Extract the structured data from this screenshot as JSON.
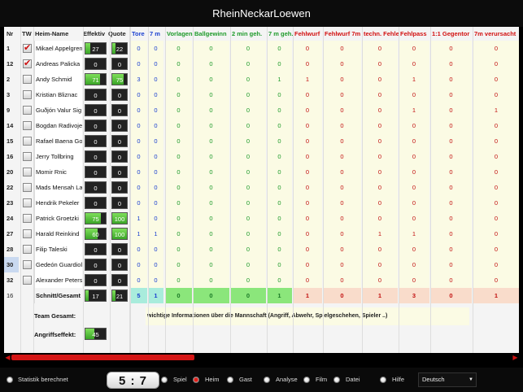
{
  "window": {
    "title": "RheinNeckarLoewen"
  },
  "colors": {
    "accent_red": "#d41515",
    "effekt_green": "#3aa427",
    "blue_stat": "#1a3fd0",
    "green_stat": "#1d9a2a",
    "red_stat": "#c21010"
  },
  "columns": {
    "nr": "Nr",
    "tw": "TW",
    "name": "Heim-Name",
    "effektiv": "Effektiv",
    "quote": "Quote",
    "stats": [
      {
        "label": "Tore",
        "color": "blue"
      },
      {
        "label": "7 m",
        "color": "blue"
      },
      {
        "label": "Vorlagen",
        "color": "green"
      },
      {
        "label": "Ballgewinn",
        "color": "green"
      },
      {
        "label": "2 min geh.",
        "color": "green"
      },
      {
        "label": "7 m geh.",
        "color": "green"
      },
      {
        "label": "Fehlwurf",
        "color": "red"
      },
      {
        "label": "Fehlwurf 7m",
        "color": "red"
      },
      {
        "label": "techn. Fehler",
        "color": "red"
      },
      {
        "label": "Fehlpass",
        "color": "red"
      },
      {
        "label": "1:1 Gegentor",
        "color": "red"
      },
      {
        "label": "7m verursacht",
        "color": "red"
      }
    ]
  },
  "players": [
    {
      "nr": "1",
      "tw": true,
      "name": "Mikael Appelgren",
      "effektiv": "27",
      "eff_level": 0.25,
      "quote": "22",
      "quo_level": 0.2,
      "stats": [
        "0",
        "0",
        "0",
        "0",
        "0",
        "0",
        "0",
        "0",
        "0",
        "0",
        "0",
        "0"
      ]
    },
    {
      "nr": "12",
      "tw": true,
      "name": "Andreas Palicka",
      "effektiv": "0",
      "eff_level": 0,
      "quote": "0",
      "quo_level": 0,
      "stats": [
        "0",
        "0",
        "0",
        "0",
        "0",
        "0",
        "0",
        "0",
        "0",
        "0",
        "0",
        "0"
      ]
    },
    {
      "nr": "2",
      "tw": false,
      "name": "Andy Schmid",
      "effektiv": "71",
      "eff_level": 0.7,
      "quote": "75",
      "quo_level": 0.75,
      "stats": [
        "3",
        "0",
        "0",
        "0",
        "0",
        "1",
        "1",
        "0",
        "0",
        "1",
        "0",
        "0"
      ]
    },
    {
      "nr": "3",
      "tw": false,
      "name": "Kristian Bliznac",
      "effektiv": "0",
      "eff_level": 0,
      "quote": "0",
      "quo_level": 0,
      "stats": [
        "0",
        "0",
        "0",
        "0",
        "0",
        "0",
        "0",
        "0",
        "0",
        "0",
        "0",
        "0"
      ]
    },
    {
      "nr": "9",
      "tw": false,
      "name": "Guðjón Valur Sig",
      "effektiv": "0",
      "eff_level": 0,
      "quote": "0",
      "quo_level": 0,
      "stats": [
        "0",
        "0",
        "0",
        "0",
        "0",
        "0",
        "0",
        "0",
        "0",
        "1",
        "0",
        "1"
      ]
    },
    {
      "nr": "14",
      "tw": false,
      "name": "Bogdan Radivoje",
      "effektiv": "0",
      "eff_level": 0,
      "quote": "0",
      "quo_level": 0,
      "stats": [
        "0",
        "0",
        "0",
        "0",
        "0",
        "0",
        "0",
        "0",
        "0",
        "0",
        "0",
        "0"
      ]
    },
    {
      "nr": "15",
      "tw": false,
      "name": "Rafael Baena Go",
      "effektiv": "0",
      "eff_level": 0,
      "quote": "0",
      "quo_level": 0,
      "stats": [
        "0",
        "0",
        "0",
        "0",
        "0",
        "0",
        "0",
        "0",
        "0",
        "0",
        "0",
        "0"
      ]
    },
    {
      "nr": "16",
      "tw": false,
      "name": "Jerry Tollbring",
      "effektiv": "0",
      "eff_level": 0,
      "quote": "0",
      "quo_level": 0,
      "stats": [
        "0",
        "0",
        "0",
        "0",
        "0",
        "0",
        "0",
        "0",
        "0",
        "0",
        "0",
        "0"
      ]
    },
    {
      "nr": "20",
      "tw": false,
      "name": "Momir Rnic",
      "effektiv": "0",
      "eff_level": 0,
      "quote": "0",
      "quo_level": 0,
      "stats": [
        "0",
        "0",
        "0",
        "0",
        "0",
        "0",
        "0",
        "0",
        "0",
        "0",
        "0",
        "0"
      ]
    },
    {
      "nr": "22",
      "tw": false,
      "name": "Mads Mensah La",
      "effektiv": "0",
      "eff_level": 0,
      "quote": "0",
      "quo_level": 0,
      "stats": [
        "0",
        "0",
        "0",
        "0",
        "0",
        "0",
        "0",
        "0",
        "0",
        "0",
        "0",
        "0"
      ]
    },
    {
      "nr": "23",
      "tw": false,
      "name": "Hendrik Pekeler",
      "effektiv": "0",
      "eff_level": 0,
      "quote": "0",
      "quo_level": 0,
      "stats": [
        "0",
        "0",
        "0",
        "0",
        "0",
        "0",
        "0",
        "0",
        "0",
        "0",
        "0",
        "0"
      ]
    },
    {
      "nr": "24",
      "tw": false,
      "name": "Patrick Groetzki",
      "effektiv": "75",
      "eff_level": 0.75,
      "quote": "100",
      "quo_level": 1.0,
      "stats": [
        "1",
        "0",
        "0",
        "0",
        "0",
        "0",
        "0",
        "0",
        "0",
        "0",
        "0",
        "0"
      ]
    },
    {
      "nr": "27",
      "tw": false,
      "name": "Harald Reinkind",
      "effektiv": "60",
      "eff_level": 0.6,
      "quote": "100",
      "quo_level": 1.0,
      "stats": [
        "1",
        "1",
        "0",
        "0",
        "0",
        "0",
        "0",
        "0",
        "1",
        "1",
        "0",
        "0"
      ]
    },
    {
      "nr": "28",
      "tw": false,
      "name": "Filip Taleski",
      "effektiv": "0",
      "eff_level": 0,
      "quote": "0",
      "quo_level": 0,
      "stats": [
        "0",
        "0",
        "0",
        "0",
        "0",
        "0",
        "0",
        "0",
        "0",
        "0",
        "0",
        "0"
      ]
    },
    {
      "nr": "30",
      "tw": false,
      "name": "Gedeón Guardiola",
      "effektiv": "0",
      "eff_level": 0,
      "quote": "0",
      "quo_level": 0,
      "stats": [
        "0",
        "0",
        "0",
        "0",
        "0",
        "0",
        "0",
        "0",
        "0",
        "0",
        "0",
        "0"
      ]
    },
    {
      "nr": "32",
      "tw": false,
      "name": "Alexander Petersson",
      "effektiv": "0",
      "eff_level": 0,
      "quote": "0",
      "quo_level": 0,
      "stats": [
        "0",
        "0",
        "0",
        "0",
        "0",
        "0",
        "0",
        "0",
        "0",
        "0",
        "0",
        "0"
      ]
    }
  ],
  "summary": {
    "nr": "16",
    "name": "Schnitt/Gesamt",
    "effektiv": "17",
    "eff_level": 0.17,
    "quote": "21",
    "quo_level": 0.21,
    "stats": [
      "5",
      "1",
      "0",
      "0",
      "0",
      "1",
      "1",
      "0",
      "1",
      "3",
      "0",
      "1"
    ]
  },
  "team": {
    "label": "Team Gesamt:",
    "info": "wichtige Informationen über die Mannschaft (Angriff, Abwehr, Spielgeschehen, Spieler ..)",
    "attack_label": "Angriffseffekt:",
    "attack_value": "45",
    "attack_level": 0.45
  },
  "bottom": {
    "stat_label": "Statistik berechnet",
    "score": "5 : 7",
    "options": [
      "Spiel",
      "Heim",
      "Gast",
      "Analyse",
      "Film",
      "Datei",
      "Hilfe"
    ],
    "selected": "Heim",
    "language": "Deutsch"
  },
  "scroll": {
    "position": 0.37
  }
}
